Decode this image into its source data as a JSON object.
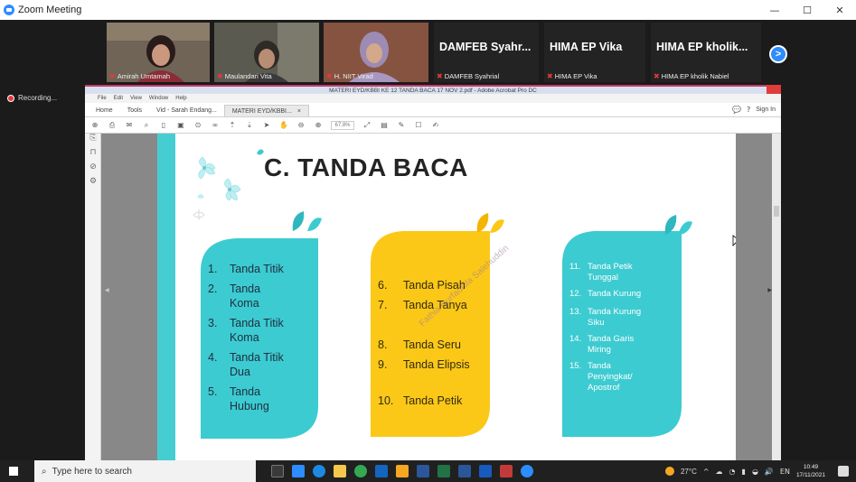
{
  "window": {
    "title": "Zoom Meeting",
    "minimize": "—",
    "restore": "☐",
    "close": "✕"
  },
  "participants": [
    {
      "name": "Amirah Umtamah",
      "kind": "video",
      "bg": "#6a5e52"
    },
    {
      "name": "Maulandari Vita",
      "kind": "video",
      "bg": "#7a6b5a"
    },
    {
      "name": "H. NIIT Virad",
      "kind": "video",
      "bg": "#8a5a46"
    },
    {
      "name": "DAMFEB Syahr...",
      "sub": "DAMFEB Syahrial",
      "kind": "text"
    },
    {
      "name": "HIMA EP Vika",
      "sub": "HIMA EP Vika",
      "kind": "text"
    },
    {
      "name": "HIMA EP kholik...",
      "sub": "HIMA EP kholik Nabiel",
      "kind": "text"
    }
  ],
  "next_button": ">",
  "recording": "Recording...",
  "acrobat": {
    "title": "MATERI EYD/KBBI KE 12 TANDA BACA 17 NOV 2.pdf - Adobe Acrobat Pro DC",
    "menu": [
      "File",
      "Edit",
      "View",
      "Window",
      "Help"
    ],
    "tabs": [
      "Home",
      "Tools",
      "Vid - Sarah Endang...",
      "MATERI EYD/KBBI..."
    ],
    "tab_close": "×",
    "right_items": [
      "Sign In"
    ],
    "zoom": "67.8%"
  },
  "slide": {
    "title": "C. TANDA BACA",
    "watermark": "Fathia Nurfadhila Salehuddin",
    "colors": {
      "teal": "#3ccbd1",
      "yellow": "#fcc818",
      "stripe": "#45cdd2"
    },
    "card1": [
      {
        "n": "1.",
        "t": "Tanda Titik"
      },
      {
        "n": "2.",
        "t": "Tanda Koma"
      },
      {
        "n": "3.",
        "t": "Tanda Titik Koma"
      },
      {
        "n": "4.",
        "t": "Tanda Titik Dua"
      },
      {
        "n": "5.",
        "t": "Tanda Hubung"
      }
    ],
    "card2": [
      {
        "n": "6.",
        "t": "Tanda Pisah"
      },
      {
        "n": "7.",
        "t": "Tanda Tanya"
      },
      {
        "n": "8.",
        "t": "Tanda Seru"
      },
      {
        "n": "9.",
        "t": "Tanda Elipsis"
      },
      {
        "n": "10.",
        "t": "Tanda Petik"
      }
    ],
    "card3": [
      {
        "n": "11.",
        "t": "Tanda Petik Tunggal"
      },
      {
        "n": "12.",
        "t": "Tanda Kurung"
      },
      {
        "n": "13.",
        "t": "Tanda Kurung Siku"
      },
      {
        "n": "14.",
        "t": "Tanda Garis Miring"
      },
      {
        "n": "15.",
        "t": "Tanda Penyingkat/ Apostrof"
      }
    ]
  },
  "taskbar": {
    "search_placeholder": "Type here to search",
    "weather": "27°C",
    "time": "10:49",
    "date": "17/11/2021"
  }
}
